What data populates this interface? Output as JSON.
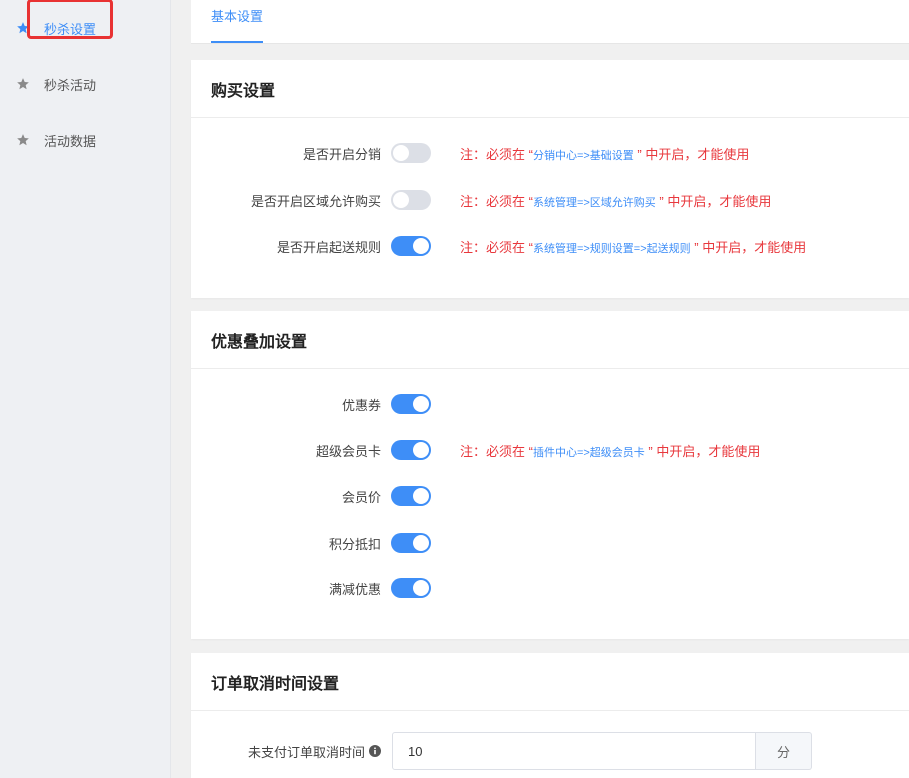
{
  "sidebar": {
    "items": [
      {
        "label": "秒杀设置",
        "icon": "star-icon",
        "active": true
      },
      {
        "label": "秒杀活动",
        "icon": "star-icon",
        "active": false
      },
      {
        "label": "活动数据",
        "icon": "star-icon",
        "active": false
      }
    ]
  },
  "tabs": [
    {
      "label": "基本设置",
      "active": true
    }
  ],
  "purchase": {
    "title": "购买设置",
    "rows": [
      {
        "label": "是否开启分销",
        "enabled": false,
        "note_prefix": "注：必须在 “",
        "note_link": "分销中心=>基础设置",
        "note_suffix": " ” 中开启，才能使用"
      },
      {
        "label": "是否开启区域允许购买",
        "enabled": false,
        "note_prefix": "注：必须在 “",
        "note_link": "系统管理=>区域允许购买",
        "note_suffix": " ” 中开启，才能使用"
      },
      {
        "label": "是否开启起送规则",
        "enabled": true,
        "note_prefix": "注：必须在 “",
        "note_link": "系统管理=>规则设置=>起送规则",
        "note_suffix": " ” 中开启，才能使用"
      }
    ]
  },
  "discount": {
    "title": "优惠叠加设置",
    "rows": [
      {
        "label": "优惠券",
        "enabled": true
      },
      {
        "label": "超级会员卡",
        "enabled": true,
        "note_prefix": "注：必须在 “",
        "note_link": "插件中心=>超级会员卡",
        "note_suffix": " ” 中开启，才能使用"
      },
      {
        "label": "会员价",
        "enabled": true
      },
      {
        "label": "积分抵扣",
        "enabled": true
      },
      {
        "label": "满减优惠",
        "enabled": true
      }
    ]
  },
  "order_cancel": {
    "title": "订单取消时间设置",
    "field_label": "未支付订单取消时间",
    "field_value": "10",
    "field_unit": "分"
  },
  "colors": {
    "accent": "#3e8ef7",
    "warning": "#e8383d",
    "highlight_box": "#e83232"
  }
}
